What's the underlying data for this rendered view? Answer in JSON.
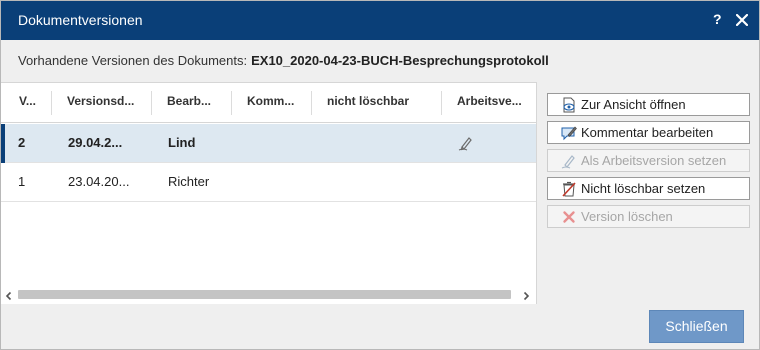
{
  "dialog": {
    "title": "Dokumentversionen",
    "help_label": "?",
    "info_label": "Vorhandene Versionen des Dokuments:",
    "document_name": "EX10_2020-04-23-BUCH-Besprechungsprotokoll"
  },
  "table": {
    "columns": [
      "V...",
      "Versionsd...",
      "Bearb...",
      "Komm...",
      "nicht löschbar",
      "Arbeitsve..."
    ],
    "rows": [
      {
        "version": "2",
        "date": "29.04.2...",
        "editor": "Lind",
        "comment": "",
        "not_deletable": "",
        "working_version_icon": "pen-icon",
        "selected": true
      },
      {
        "version": "1",
        "date": "23.04.20...",
        "editor": "Richter",
        "comment": "",
        "not_deletable": "",
        "working_version_icon": "",
        "selected": false
      }
    ]
  },
  "actions": [
    {
      "label": "Zur Ansicht öffnen",
      "icon": "view-document-icon",
      "enabled": true
    },
    {
      "label": "Kommentar bearbeiten",
      "icon": "edit-comment-icon",
      "enabled": true
    },
    {
      "label": "Als Arbeitsversion setzen",
      "icon": "set-working-version-icon",
      "enabled": false
    },
    {
      "label": "Nicht löschbar setzen",
      "icon": "protect-icon",
      "enabled": true
    },
    {
      "label": "Version löschen",
      "icon": "delete-icon",
      "enabled": false
    }
  ],
  "footer": {
    "close_label": "Schließen"
  },
  "colors": {
    "titlebar": "#0a3f78",
    "selected_row": "#dde8f1",
    "primary_button": "#6f98c8",
    "delete_icon": "#e06666"
  }
}
